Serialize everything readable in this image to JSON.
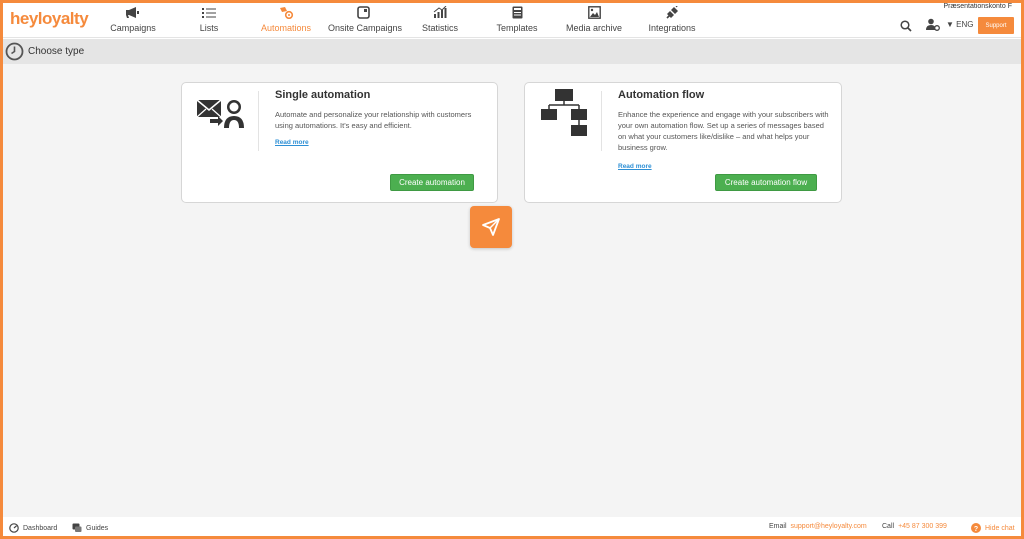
{
  "app": {
    "logo": "heyloyalty",
    "account_name": "Præsentationskonto F"
  },
  "nav": {
    "items": [
      {
        "label": "Campaigns",
        "icon": "megaphone-icon"
      },
      {
        "label": "Lists",
        "icon": "list-icon"
      },
      {
        "label": "Automations",
        "icon": "automation-icon"
      },
      {
        "label": "Onsite Campaigns",
        "icon": "onsite-icon"
      },
      {
        "label": "Statistics",
        "icon": "chart-icon"
      },
      {
        "label": "Templates",
        "icon": "template-icon"
      },
      {
        "label": "Media archive",
        "icon": "image-icon"
      },
      {
        "label": "Integrations",
        "icon": "plug-icon"
      }
    ],
    "active": "Automations",
    "language": "ENG",
    "support_label": "Support"
  },
  "page": {
    "title": "Choose type"
  },
  "cards": [
    {
      "title": "Single automation",
      "description": "Automate and personalize your relationship with customers using automations. It's easy and efficient.",
      "read_more": "Read more",
      "button": "Create automation",
      "icon": "mail-user-icon"
    },
    {
      "title": "Automation flow",
      "description": "Enhance the experience and engage with your subscribers with your own automation flow. Set up a series of messages based on what your customers like/dislike – and what helps your business grow.",
      "read_more": "Read more",
      "button": "Create automation flow",
      "icon": "flowchart-icon"
    }
  ],
  "footer": {
    "dashboard": "Dashboard",
    "guides": "Guides",
    "email_label": "Email",
    "email": "support@heyloyalty.com",
    "call_label": "Call",
    "phone": "+45 87 300 399",
    "hide_chat": "Hide chat"
  },
  "colors": {
    "brand": "#f58a3c",
    "button_green": "#4caf50",
    "link_blue": "#2d8fd5"
  }
}
